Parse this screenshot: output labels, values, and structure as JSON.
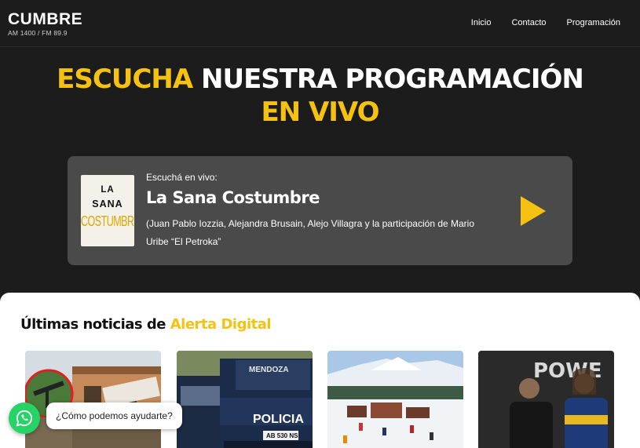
{
  "header": {
    "logo_main": "CUMBRE",
    "logo_sub": "AM 1400  /  FM 89.9",
    "nav": [
      "Inicio",
      "Contacto",
      "Programación"
    ]
  },
  "hero": {
    "part1": "ESCUCHA",
    "part2": "NUESTRA PROGRAMACIÓN",
    "part3": "EN VIVO"
  },
  "player": {
    "label": "Escuchá en vivo:",
    "title": "La Sana Costumbre",
    "description": "(Juan Pablo Iozzia, Alejandra Brusain, Alejo Villagra y la participación de Mario Uribe “El Petroka”",
    "cover": {
      "line1": "LA",
      "line2": "SANA",
      "line3": "COSTUMBRE"
    },
    "play_icon": "play-icon"
  },
  "news": {
    "title_prefix": "Últimas noticias de",
    "title_brand": "Alerta Digital",
    "cards": [
      {
        "image": "oil-pump-and-building"
      },
      {
        "image": "police-vehicle",
        "text_1": "MENDOZA",
        "text_2": "POLICIA",
        "text_3": "AB 530 NS"
      },
      {
        "image": "ski-resort-snow"
      },
      {
        "image": "football-players",
        "text_1": "POWE"
      }
    ]
  },
  "whatsapp": {
    "icon": "whatsapp-icon",
    "prompt": "¿Cómo podemos ayudarte?"
  },
  "colors": {
    "accent_yellow": "#f5c211",
    "background_dark": "#1c1c1c",
    "player_bg": "#4a4a4a",
    "whatsapp_green": "#25d366"
  }
}
